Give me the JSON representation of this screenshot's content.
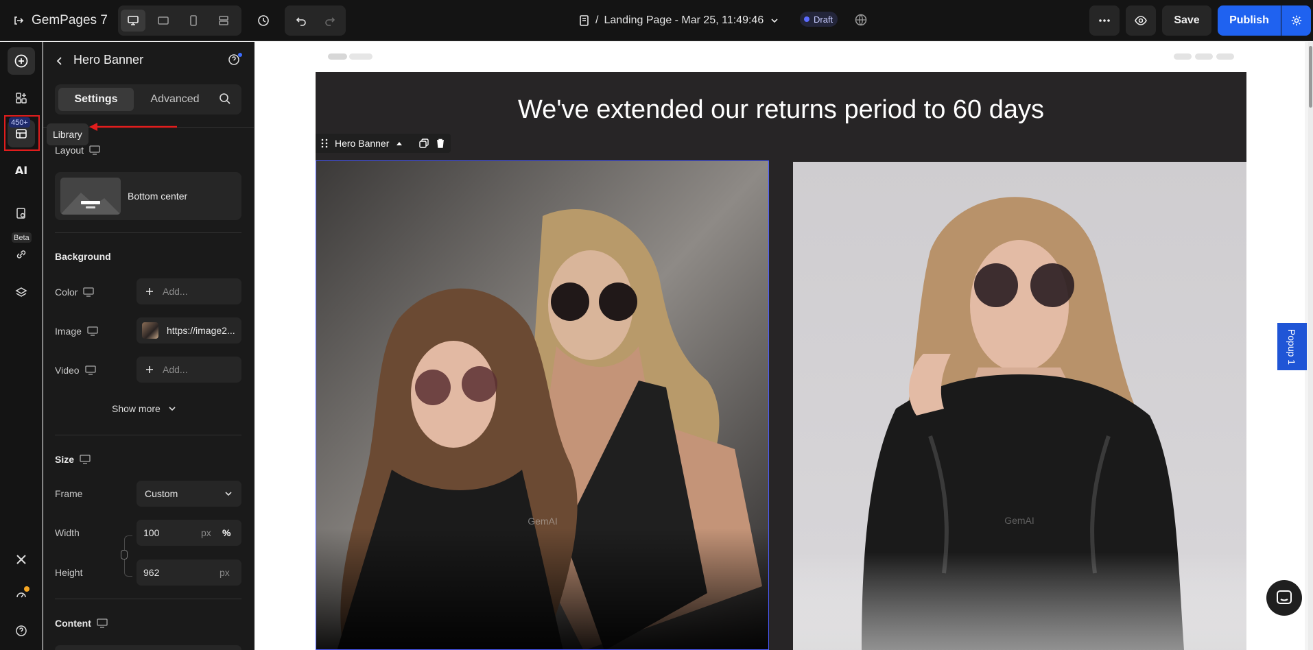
{
  "app": {
    "brand": "GemPages 7"
  },
  "topbar": {
    "page_prefix": "/",
    "page_title": "Landing Page - Mar 25, 11:49:46",
    "status": "Draft",
    "save_label": "Save",
    "publish_label": "Publish"
  },
  "rail": {
    "library_badge": "450+",
    "library_tooltip": "Library",
    "beta_label": "Beta",
    "ai_label": "AI"
  },
  "panel": {
    "title": "Hero Banner",
    "tabs": [
      "Settings",
      "Advanced"
    ],
    "layout": {
      "heading": "Layout",
      "value": "Bottom center"
    },
    "background": {
      "heading": "Background",
      "color_label": "Color",
      "color_value": "Add...",
      "image_label": "Image",
      "image_value": "https://image2...",
      "video_label": "Video",
      "video_value": "Add...",
      "show_more": "Show more"
    },
    "size": {
      "heading": "Size",
      "frame_label": "Frame",
      "frame_value": "Custom",
      "width_label": "Width",
      "width_value": "100",
      "width_units": [
        "px",
        "%"
      ],
      "height_label": "Height",
      "height_value": "962",
      "height_unit": "px"
    },
    "content": {
      "heading": "Content"
    }
  },
  "canvas": {
    "headline": "We've extended our returns period to 60 days",
    "element_tag": "Hero Banner",
    "watermark": "GemAI",
    "popup_label": "Popup 1"
  },
  "colors": {
    "accent": "#1f62f0",
    "selection": "#4d5cff",
    "highlight": "#e11d1d"
  }
}
